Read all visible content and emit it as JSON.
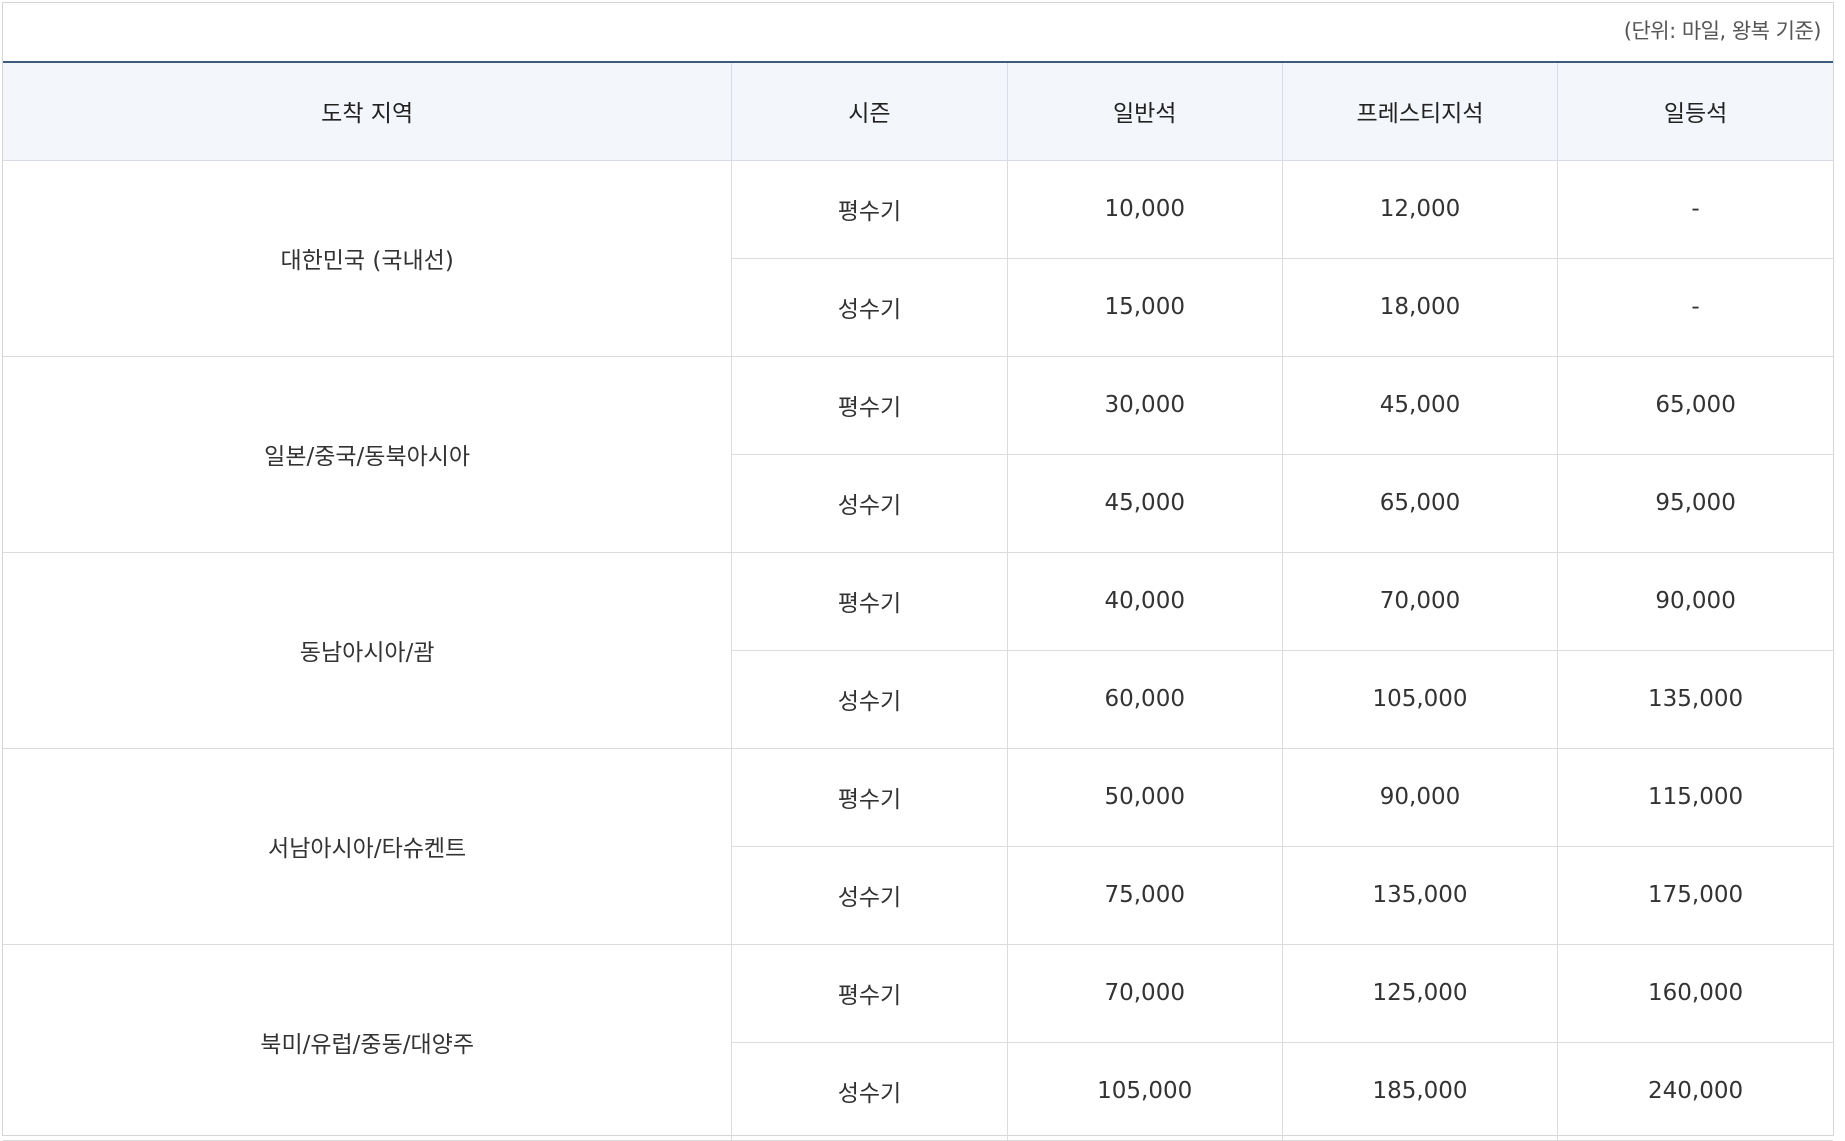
{
  "unit_note": "(단위: 마일, 왕복 기준)",
  "headers": [
    "도착 지역",
    "시즌",
    "일반석",
    "프레스티지석",
    "일등석"
  ],
  "rows": [
    {
      "region": "대한민국 (국내선)",
      "seasons": [
        {
          "season": "평수기",
          "economy": "10,000",
          "prestige": "12,000",
          "first": "-"
        },
        {
          "season": "성수기",
          "economy": "15,000",
          "prestige": "18,000",
          "first": "-"
        }
      ]
    },
    {
      "region": "일본/중국/동북아시아",
      "seasons": [
        {
          "season": "평수기",
          "economy": "30,000",
          "prestige": "45,000",
          "first": "65,000"
        },
        {
          "season": "성수기",
          "economy": "45,000",
          "prestige": "65,000",
          "first": "95,000"
        }
      ]
    },
    {
      "region": "동남아시아/괌",
      "seasons": [
        {
          "season": "평수기",
          "economy": "40,000",
          "prestige": "70,000",
          "first": "90,000"
        },
        {
          "season": "성수기",
          "economy": "60,000",
          "prestige": "105,000",
          "first": "135,000"
        }
      ]
    },
    {
      "region": "서남아시아/타슈켄트",
      "seasons": [
        {
          "season": "평수기",
          "economy": "50,000",
          "prestige": "90,000",
          "first": "115,000"
        },
        {
          "season": "성수기",
          "economy": "75,000",
          "prestige": "135,000",
          "first": "175,000"
        }
      ]
    },
    {
      "region": "북미/유럽/중동/대양주",
      "seasons": [
        {
          "season": "평수기",
          "economy": "70,000",
          "prestige": "125,000",
          "first": "160,000"
        },
        {
          "season": "성수기",
          "economy": "105,000",
          "prestige": "185,000",
          "first": "240,000"
        }
      ]
    }
  ]
}
